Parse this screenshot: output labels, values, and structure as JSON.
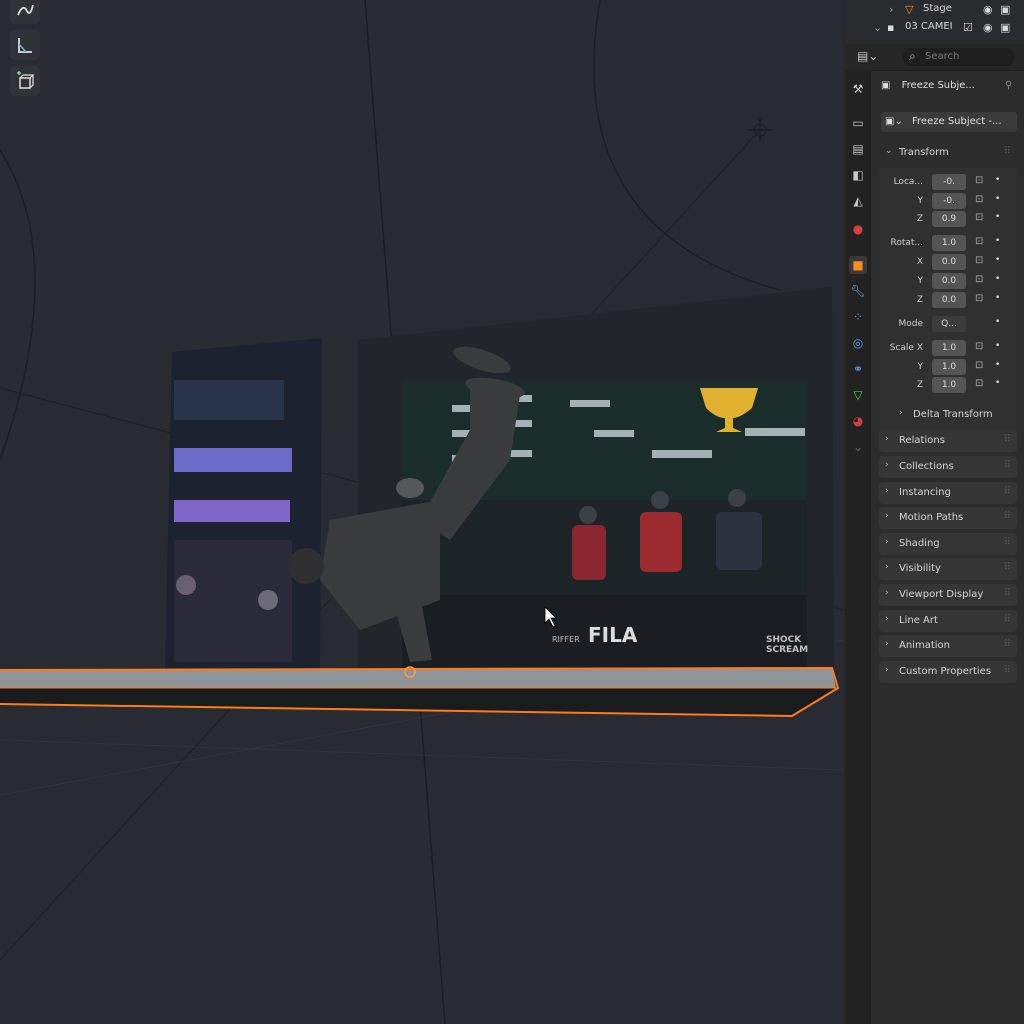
{
  "outliner": {
    "rows": [
      {
        "label": "Stage"
      },
      {
        "label": "03 CAMEI"
      }
    ]
  },
  "properties": {
    "search_placeholder": "Search",
    "object_name": "Freeze Subje...",
    "data_name": "Freeze Subject -...",
    "transform": {
      "header": "Transform",
      "location_label": "Loca...",
      "location": {
        "x": "-0.",
        "y": "-0.",
        "z": "0.9"
      },
      "rotation_label": "Rotat...",
      "rotation": {
        "w": "1.0",
        "x": "0.0",
        "y": "0.0",
        "z": "0.0"
      },
      "mode_label": "Mode",
      "mode_value": "Q...",
      "scale_label": "Scale X",
      "scale": {
        "x": "1.0",
        "y": "1.0",
        "z": "1.0"
      },
      "axis": {
        "x": "X",
        "y": "Y",
        "z": "Z"
      },
      "delta": "Delta Transform"
    },
    "sections": [
      "Relations",
      "Collections",
      "Instancing",
      "Motion Paths",
      "Shading",
      "Visibility",
      "Viewport Display",
      "Line Art",
      "Animation",
      "Custom Properties"
    ]
  },
  "scene_text": {
    "sponsors": [
      "FILA",
      "RIFFER",
      "SHOCK",
      "SCREAM"
    ]
  },
  "colors": {
    "selection": "#ff7a1a",
    "viewport_bg": "#282b31",
    "panel_bg": "#2c2c2c"
  },
  "icons": [
    "pen-tool-icon",
    "measure-icon",
    "add-cube-icon",
    "eye-icon",
    "camera-icon",
    "search-icon",
    "pin-icon",
    "lock-icon",
    "keyframe-dot-icon"
  ]
}
